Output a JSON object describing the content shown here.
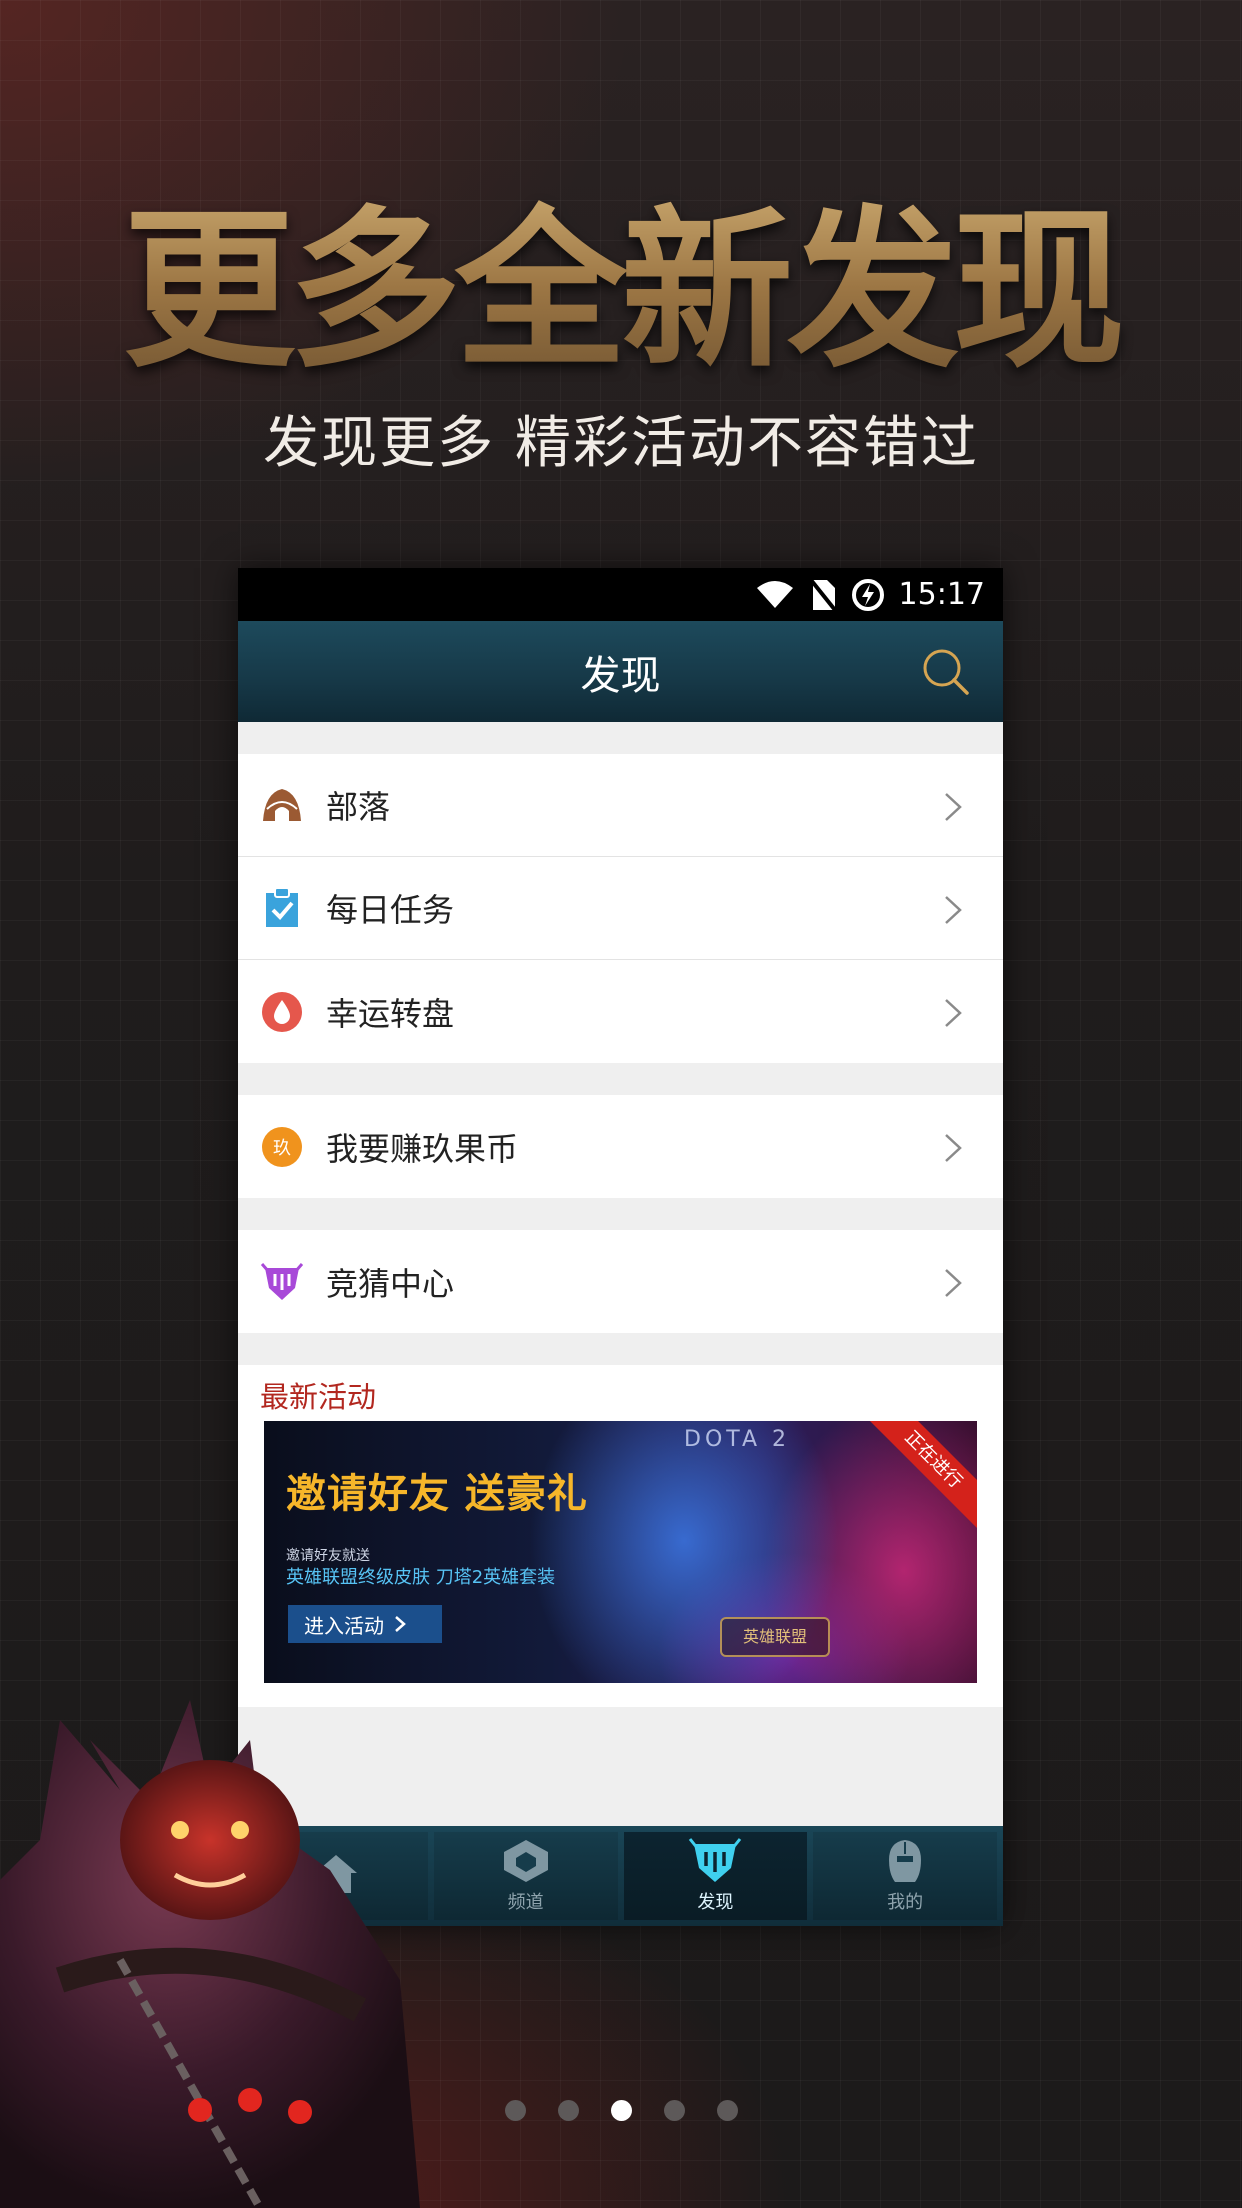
{
  "headline": "更多全新发现",
  "subline": "发现更多 精彩活动不容错过",
  "phone": {
    "status": {
      "time": "15:17"
    },
    "appbar": {
      "title": "发现"
    },
    "groups": [
      [
        {
          "label": "部落",
          "icon": "tribe-icon"
        },
        {
          "label": "每日任务",
          "icon": "clipboard-check-icon"
        },
        {
          "label": "幸运转盘",
          "icon": "drop-icon"
        }
      ],
      [
        {
          "label": "我要赚玖果币",
          "icon": "coin-icon",
          "badge": "玖"
        }
      ],
      [
        {
          "label": "竞猜中心",
          "icon": "shield-badge-icon"
        }
      ]
    ],
    "activity": {
      "title": "最新活动",
      "banner": {
        "brand": "DOTA 2",
        "title": "邀请好友 送豪礼",
        "small": "邀请好友就送",
        "desc": "英雄联盟终级皮肤 刀塔2英雄套装",
        "button": "进入活动",
        "ribbon": "正在进行",
        "logo": "英雄联盟"
      }
    },
    "tabs": [
      {
        "label": "",
        "icon": "home-icon",
        "active": false
      },
      {
        "label": "频道",
        "icon": "channel-icon",
        "active": false
      },
      {
        "label": "发现",
        "icon": "discover-icon",
        "active": true
      },
      {
        "label": "我的",
        "icon": "profile-icon",
        "active": false
      }
    ]
  },
  "pager": {
    "count": 5,
    "active": 2
  },
  "colors": {
    "accent_red": "#b2271f",
    "banner_gold": "#f6b62a",
    "appbar": "#163847"
  }
}
